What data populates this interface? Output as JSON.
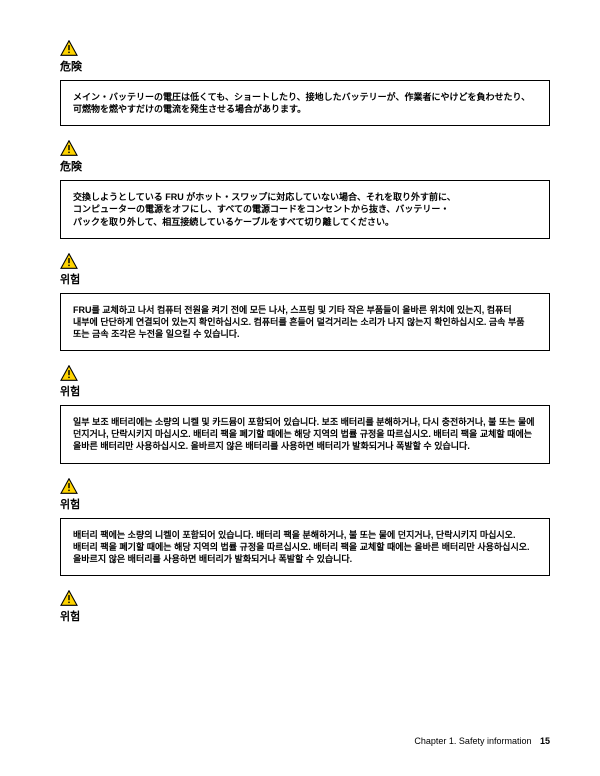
{
  "blocks": [
    {
      "label": "危険",
      "text": "メイン・バッテリーの電圧は低くても、ショートしたり、接地したバッテリーが、作業者にやけどを負わせたり、可燃物を燃やすだけの電流を発生させる場合があります。"
    },
    {
      "label": "危険",
      "text": "交換しようとしている FRU がホット・スワップに対応していない場合、それを取り外す前に、コンピューターの電源をオフにし、すべての電源コードをコンセントから抜き、バッテリー・パックを取り外して、相互接続しているケーブルをすべて切り離してください。"
    },
    {
      "label": "위험",
      "text": "FRU를 교체하고 나서 컴퓨터 전원을 켜기 전에 모든 나사, 스프링 및 기타 작은 부품들이 올바른 위치에 있는지, 컴퓨터 내부에 단단하게 연결되어 있는지 확인하십시오. 컴퓨터를 흔들어 덜걱거리는 소리가 나지 않는지 확인하십시오. 금속 부품 또는 금속 조각은 누전을 일으킬 수 있습니다."
    },
    {
      "label": "위험",
      "text": "일부 보조 배터리에는 소량의 니켈 및 카드뮴이 포함되어 있습니다. 보조 배터리를 분해하거나, 다시 충전하거나, 불 또는 물에 던지거나, 단락시키지 마십시오. 배터리 팩을 폐기할 때에는 해당 지역의 법률 규정을 따르십시오. 배터리 팩을 교체할 때에는 올바른 배터리만 사용하십시오. 올바르지 않은 배터리를 사용하면 배터리가 발화되거나 폭발할 수 있습니다."
    },
    {
      "label": "위험",
      "text": "배터리 팩에는 소량의 니켈이 포함되어 있습니다. 배터리 팩을 분해하거나, 불 또는 물에 던지거나, 단락시키지 마십시오. 배터리 팩을 폐기할 때에는 해당 지역의 법률 규정을 따르십시오. 배터리 팩을 교체할 때에는 올바른 배터리만 사용하십시오. 올바르지 않은 배터리를 사용하면 배터리가 발화되거나 폭발할 수 있습니다."
    },
    {
      "label": "위험",
      "text": null
    }
  ],
  "footer": {
    "chapter": "Chapter 1. Safety information",
    "page": "15"
  }
}
